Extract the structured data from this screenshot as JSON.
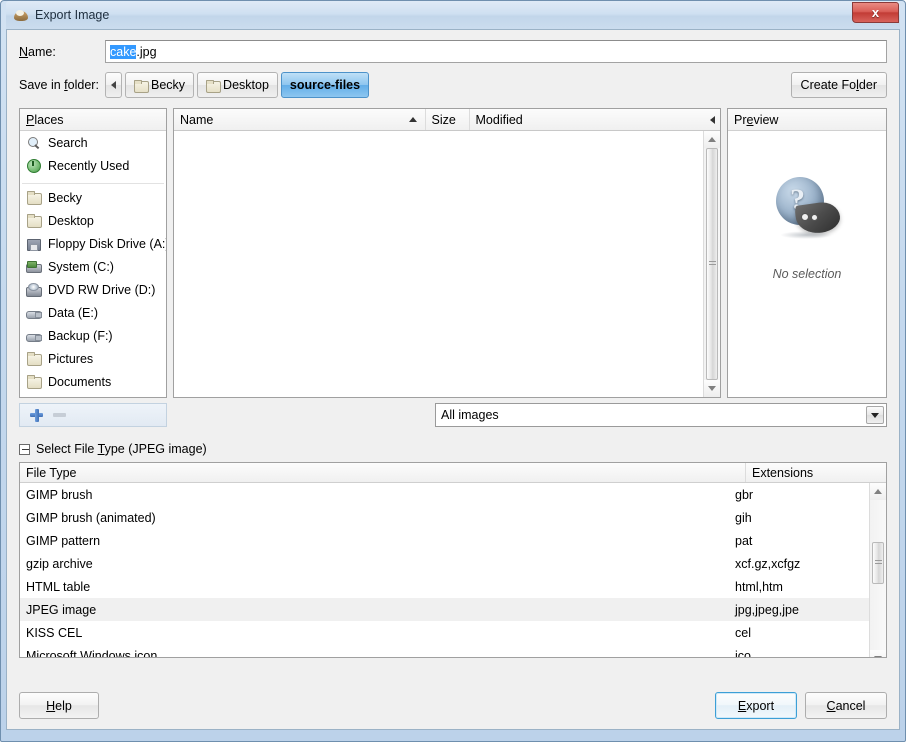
{
  "window": {
    "title": "Export Image",
    "app_icon": "gimp-wilber-icon",
    "close_label": "x"
  },
  "name_row": {
    "label_pre": "N",
    "label_mid": "ame:",
    "value_selected": "cake",
    "value_rest": ".jpg",
    "full_value": "cake.jpg"
  },
  "folder_row": {
    "label_pre": "Save in ",
    "label_mid": "f",
    "label_post": "older:",
    "back_arrow": "left-arrow",
    "crumbs": [
      {
        "label": "Becky",
        "active": false
      },
      {
        "label": "Desktop",
        "active": false
      },
      {
        "label": "source-files",
        "active": true
      }
    ],
    "create_folder_pre": "Create Fo",
    "create_folder_mid": "l",
    "create_folder_post": "der"
  },
  "places": {
    "header_pre": "P",
    "header_post": "laces",
    "items": [
      {
        "label": "Search",
        "icon": "search-icon"
      },
      {
        "label": "Recently Used",
        "icon": "recent-icon"
      },
      {
        "label": "Becky",
        "icon": "folder-icon"
      },
      {
        "label": "Desktop",
        "icon": "folder-icon"
      },
      {
        "label": "Floppy Disk Drive (A:)",
        "icon": "floppy-icon"
      },
      {
        "label": "System (C:)",
        "icon": "hdd-icon"
      },
      {
        "label": "DVD RW Drive (D:)",
        "icon": "dvd-icon"
      },
      {
        "label": "Data (E:)",
        "icon": "usb-icon"
      },
      {
        "label": "Backup (F:)",
        "icon": "usb-icon"
      },
      {
        "label": "Pictures",
        "icon": "folder-icon"
      },
      {
        "label": "Documents",
        "icon": "folder-icon"
      }
    ],
    "add_icon": "plus-icon",
    "remove_icon": "minus-icon"
  },
  "file_list": {
    "columns": [
      {
        "label": "Name",
        "sort": "ascending"
      },
      {
        "label": "Size",
        "sort": "none"
      },
      {
        "label": "Modified",
        "sort": "none"
      }
    ],
    "rows": []
  },
  "preview": {
    "header_pre": "Pr",
    "header_mid": "e",
    "header_post": "view",
    "icon": "unknown-file-icon",
    "empty_text": "No selection"
  },
  "filter": {
    "selected": "All images",
    "dropdown_icon": "chevron-down-icon"
  },
  "file_type_section": {
    "expander_state": "expanded",
    "label_pre": "Select File ",
    "label_mid": "T",
    "label_post": "ype (JPEG image)",
    "columns": [
      "File Type",
      "Extensions"
    ],
    "rows": [
      {
        "type": "GIMP brush",
        "ext": "gbr",
        "selected": false
      },
      {
        "type": "GIMP brush (animated)",
        "ext": "gih",
        "selected": false
      },
      {
        "type": "GIMP pattern",
        "ext": "pat",
        "selected": false
      },
      {
        "type": "gzip archive",
        "ext": "xcf.gz,xcfgz",
        "selected": false
      },
      {
        "type": "HTML table",
        "ext": "html,htm",
        "selected": false
      },
      {
        "type": "JPEG image",
        "ext": "jpg,jpeg,jpe",
        "selected": true
      },
      {
        "type": "KISS CEL",
        "ext": "cel",
        "selected": false
      },
      {
        "type": "Microsoft Windows icon",
        "ext": "ico",
        "selected": false
      }
    ]
  },
  "buttons": {
    "help_pre": "H",
    "help_post": "elp",
    "export_pre": "E",
    "export_post": "xport",
    "cancel_pre": "C",
    "cancel_post": "ancel"
  },
  "colors": {
    "accent_blue": "#3399ff",
    "crumb_active": "#63aee8",
    "close_red": "#c23c36",
    "focus_border": "#3c9fd6"
  }
}
